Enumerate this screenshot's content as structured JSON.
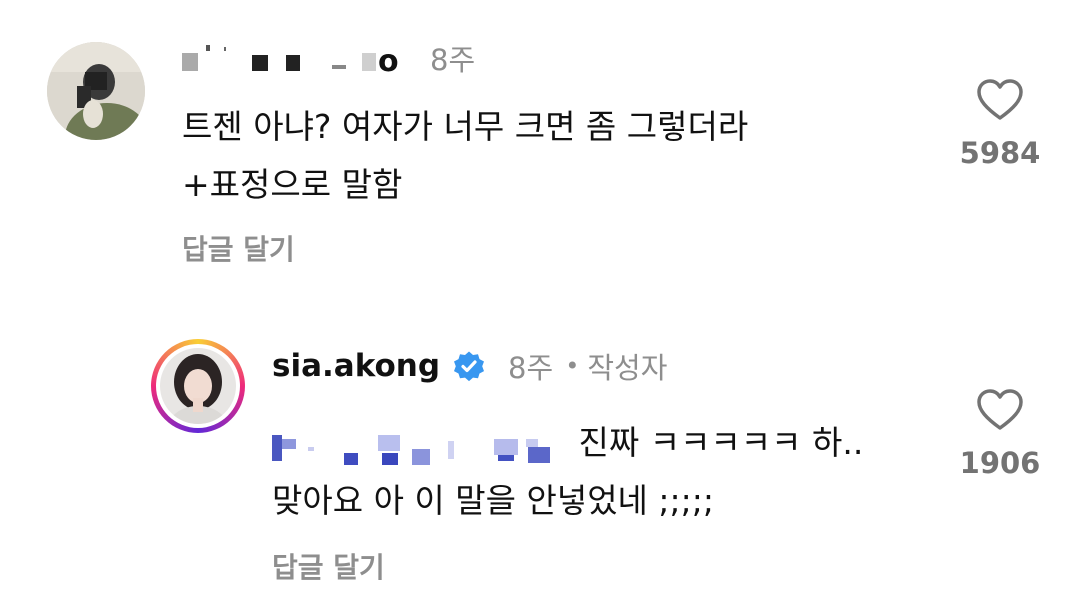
{
  "comment1": {
    "username": "i·  ■ ■  _ .oo",
    "time": "8주",
    "text_line1": "트젠 아냐? 여자가 너무 크면 좀 그렇더라",
    "text_line2": "+표정으로 말함",
    "reply_label": "답글 달기",
    "like_count": "5984",
    "like_icon": "heart-outline-icon"
  },
  "comment2": {
    "username": "sia.akong",
    "verified_icon": "verified-badge-icon",
    "time": "8주",
    "separator": "•",
    "author_tag": "작성자",
    "text_line1_suffix": "진짜 ㅋㅋㅋㅋㅋ 하..",
    "text_line2": "맞아요 아 이 말을 안넣었네 ;;;;;",
    "reply_label": "답글 달기",
    "like_count": "1906",
    "like_icon": "heart-outline-icon",
    "story_ring_colors": [
      "#f9ce34",
      "#ee2a7b",
      "#6228d7"
    ]
  }
}
